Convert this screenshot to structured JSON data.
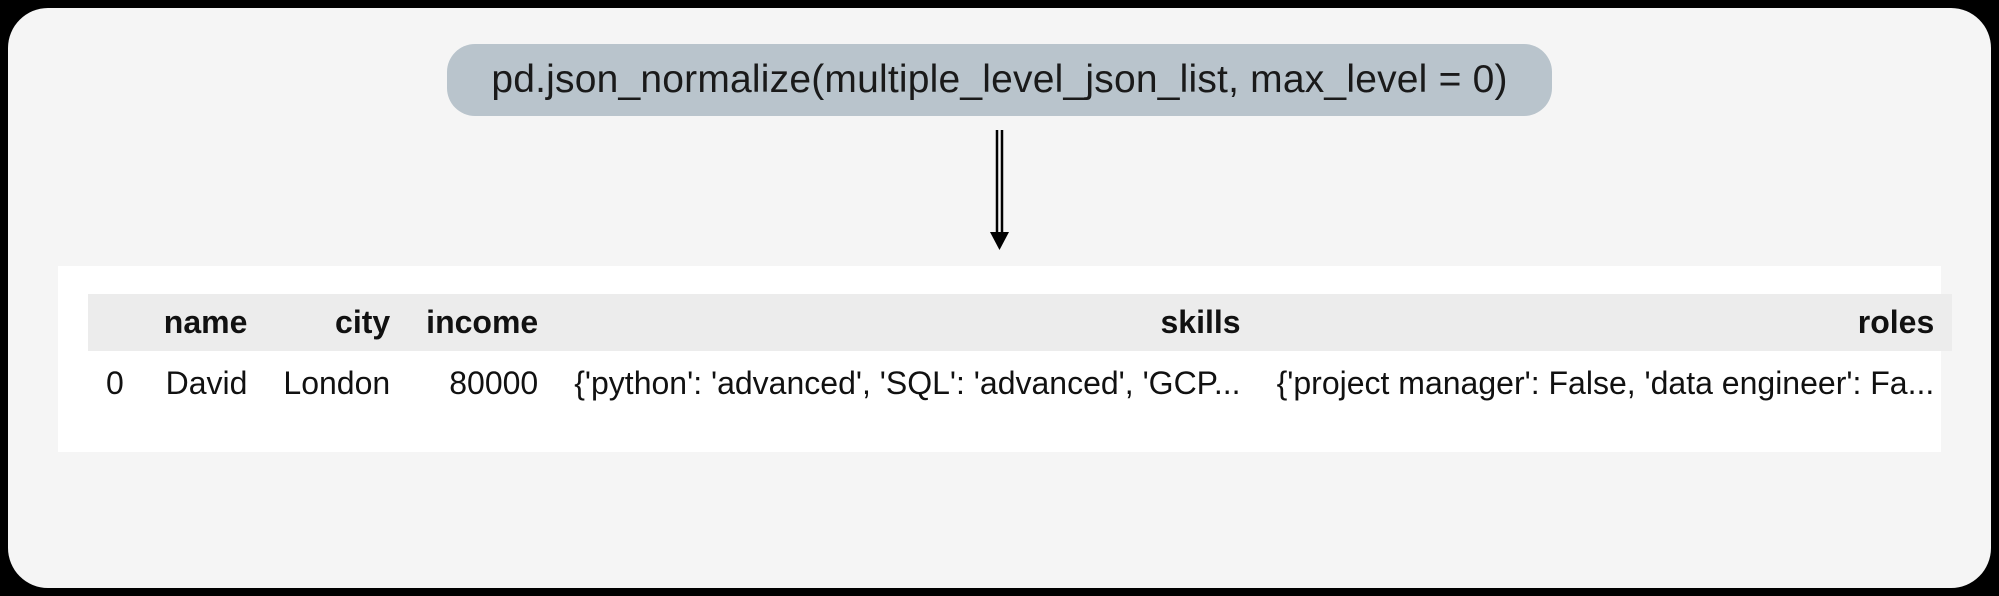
{
  "code": "pd.json_normalize(multiple_level_json_list, max_level = 0)",
  "table": {
    "columns": [
      "name",
      "city",
      "income",
      "skills",
      "roles"
    ],
    "rows": [
      {
        "index": "0",
        "name": "David",
        "city": "London",
        "income": "80000",
        "skills": "{'python': 'advanced', 'SQL': 'advanced', 'GCP...",
        "roles": "{'project manager': False, 'data engineer': Fa..."
      }
    ]
  }
}
